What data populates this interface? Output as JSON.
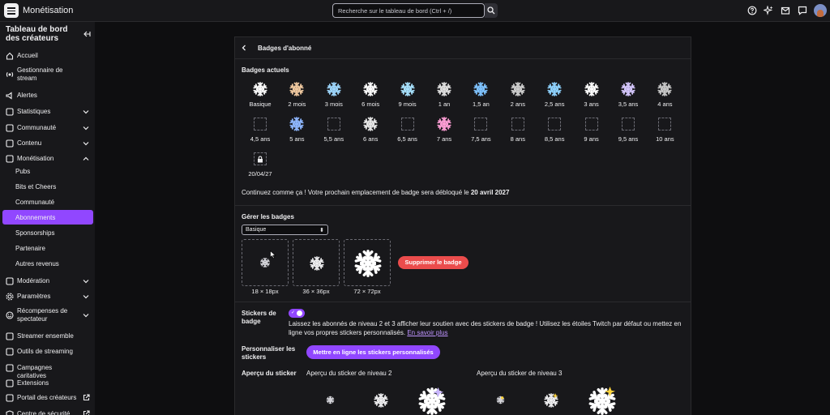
{
  "app": {
    "title": "Monétisation"
  },
  "search": {
    "placeholder": "Recherche sur le tableau de bord (Ctrl + /)"
  },
  "sidebar": {
    "title": "Tableau de bord des créateurs",
    "items": [
      {
        "label": "Accueil"
      },
      {
        "label": "Gestionnaire de stream"
      },
      {
        "label": "Alertes"
      },
      {
        "label": "Statistiques"
      },
      {
        "label": "Communauté"
      },
      {
        "label": "Contenu"
      },
      {
        "label": "Monétisation"
      },
      {
        "label": "Modération"
      },
      {
        "label": "Paramètres"
      },
      {
        "label": "Récompenses de spectateur"
      },
      {
        "label": "Streamer ensemble"
      },
      {
        "label": "Outils de streaming"
      },
      {
        "label": "Campagnes caritatives"
      },
      {
        "label": "Extensions"
      },
      {
        "label": "Portail des créateurs"
      },
      {
        "label": "Centre de sécurité"
      }
    ],
    "subitems": [
      {
        "label": "Pubs"
      },
      {
        "label": "Bits et Cheers"
      },
      {
        "label": "Communauté"
      },
      {
        "label": "Abonnements"
      },
      {
        "label": "Sponsorships"
      },
      {
        "label": "Partenaire"
      },
      {
        "label": "Autres revenus"
      }
    ]
  },
  "panel": {
    "title": "Badges d'abonné",
    "current_badges_heading": "Badges actuels",
    "badges": [
      {
        "label": "Basique"
      },
      {
        "label": "2 mois"
      },
      {
        "label": "3 mois"
      },
      {
        "label": "6 mois"
      },
      {
        "label": "9 mois"
      },
      {
        "label": "1 an"
      },
      {
        "label": "1,5 an"
      },
      {
        "label": "2 ans"
      },
      {
        "label": "2,5 ans"
      },
      {
        "label": "3 ans"
      },
      {
        "label": "3,5 ans"
      },
      {
        "label": "4 ans"
      },
      {
        "label": "4,5 ans"
      },
      {
        "label": "5 ans"
      },
      {
        "label": "5,5 ans"
      },
      {
        "label": "6 ans"
      },
      {
        "label": "6,5 ans"
      },
      {
        "label": "7 ans"
      },
      {
        "label": "7,5 ans"
      },
      {
        "label": "8 ans"
      },
      {
        "label": "8,5 ans"
      },
      {
        "label": "9 ans"
      },
      {
        "label": "9,5 ans"
      },
      {
        "label": "10 ans"
      },
      {
        "label": "20/04/27"
      }
    ],
    "next_slot_text": "Continuez comme ça ! Votre prochain emplacement de badge sera débloqué le",
    "next_slot_date": "20 avril 2027",
    "manage_heading": "Gérer les badges",
    "select_value": "Basique",
    "sizes": [
      "18 × 18px",
      "36 × 36px",
      "72 × 72px"
    ],
    "delete_label": "Supprimer le badge",
    "stickers_heading": "Stickers de badge",
    "toggle_on": true,
    "stickers_text": "Laissez les abonnés de niveau 2 et 3 afficher leur soutien avec des stickers de badge ! Utilisez les étoiles Twitch par défaut ou mettez en ligne vos propres stickers personnalisés.",
    "learn_more": "En savoir plus",
    "customize_heading": "Personnaliser les stickers",
    "upload_label": "Mettre en ligne les stickers personnalisés",
    "preview_heading": "Aperçu du sticker",
    "preview_tier2": "Aperçu du sticker de niveau 2",
    "preview_tier3": "Aperçu du sticker de niveau 3"
  },
  "colors": {
    "accent": "#9147ff",
    "danger": "#eb4c4c",
    "background": "#0e0e10",
    "surface": "#18181b"
  },
  "icons": [
    "menu-icon",
    "search-icon",
    "help-icon",
    "sparkle-icon",
    "inbox-icon",
    "whispers-icon",
    "snowflake-icon",
    "lock-icon",
    "chevron-down-icon",
    "external-link-icon"
  ]
}
